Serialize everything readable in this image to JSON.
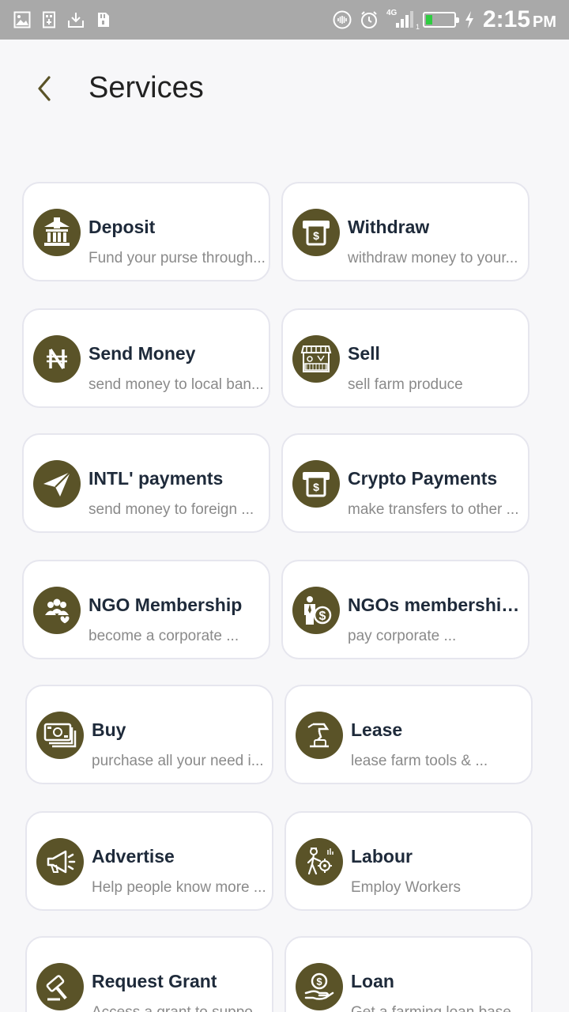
{
  "status_bar": {
    "time": "2:15",
    "ampm": "PM",
    "network": "4G",
    "sim_index": "1"
  },
  "header": {
    "title": "Services"
  },
  "services": [
    {
      "title": "Deposit",
      "desc": "Fund your purse through...",
      "icon": "bank-icon"
    },
    {
      "title": "Withdraw",
      "desc": "withdraw money to your...",
      "icon": "atm-icon"
    },
    {
      "title": "Send Money",
      "desc": "send money to local ban...",
      "icon": "naira-icon"
    },
    {
      "title": "Sell",
      "desc": "sell farm produce",
      "icon": "market-stall-icon"
    },
    {
      "title": "INTL' payments",
      "desc": "send money to foreign ...",
      "icon": "paper-plane-icon"
    },
    {
      "title": "Crypto Payments",
      "desc": "make transfers to other ...",
      "icon": "atm-icon"
    },
    {
      "title": "NGO Membership",
      "desc": "become a corporate ...",
      "icon": "community-icon"
    },
    {
      "title": "NGOs membership ...",
      "desc": "pay corporate ...",
      "icon": "member-dollar-icon"
    },
    {
      "title": "Buy",
      "desc": "purchase all your need i...",
      "icon": "cash-stack-icon"
    },
    {
      "title": "Lease",
      "desc": "lease farm tools & ...",
      "icon": "lease-hand-icon"
    },
    {
      "title": "Advertise",
      "desc": "Help people know more ...",
      "icon": "megaphone-icon"
    },
    {
      "title": "Labour",
      "desc": "Employ Workers",
      "icon": "worker-icon"
    },
    {
      "title": "Request Grant",
      "desc": "Access a grant to suppo...",
      "icon": "gavel-icon"
    },
    {
      "title": "Loan",
      "desc": "Get a farming loan base...",
      "icon": "loan-hand-icon"
    }
  ],
  "colors": {
    "accent": "#5a5328",
    "title_text": "#1e2a3a",
    "desc_text": "#8a8a8a",
    "status_bar": "#a9a9a9"
  }
}
